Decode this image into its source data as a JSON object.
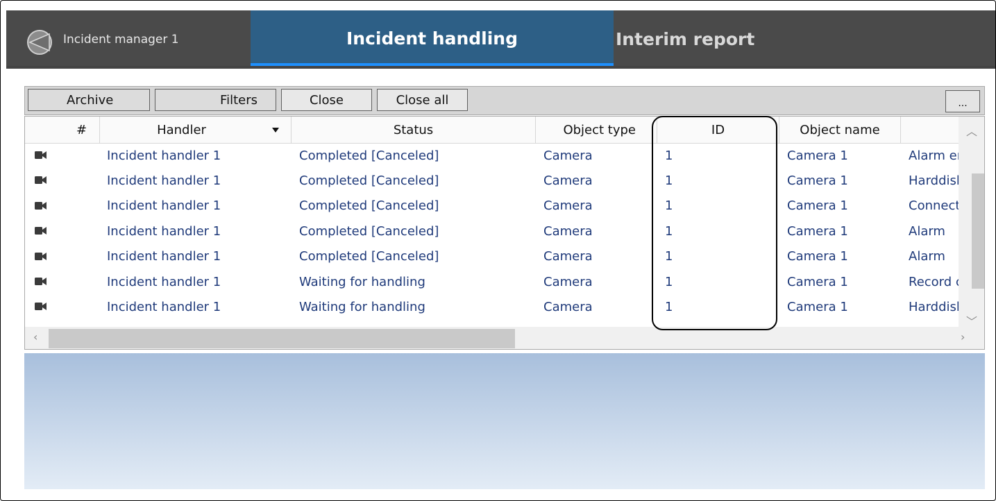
{
  "window": {
    "title": "Incident manager 1",
    "tabs": [
      {
        "label": "Incident handling",
        "active": true
      },
      {
        "label": "Interim report",
        "active": false
      }
    ]
  },
  "toolbar": {
    "archive": "Archive",
    "filters": "Filters",
    "close": "Close",
    "close_all": "Close all",
    "more": "..."
  },
  "table": {
    "columns": [
      "#",
      "Handler",
      "Status",
      "Object type",
      "ID",
      "Object name"
    ],
    "rows": [
      {
        "icon": "camera-icon",
        "handler": "Incident handler 1",
        "status": "Completed [Canceled]",
        "object_type": "Camera",
        "id": "1",
        "object_name": "Camera 1",
        "event": "Alarm er"
      },
      {
        "icon": "camera-icon",
        "handler": "Incident handler 1",
        "status": "Completed [Canceled]",
        "object_type": "Camera",
        "id": "1",
        "object_name": "Camera 1",
        "event": "Harddisk"
      },
      {
        "icon": "camera-icon",
        "handler": "Incident handler 1",
        "status": "Completed [Canceled]",
        "object_type": "Camera",
        "id": "1",
        "object_name": "Camera 1",
        "event": "Connect"
      },
      {
        "icon": "camera-icon",
        "handler": "Incident handler 1",
        "status": "Completed [Canceled]",
        "object_type": "Camera",
        "id": "1",
        "object_name": "Camera 1",
        "event": "Alarm"
      },
      {
        "icon": "camera-icon",
        "handler": "Incident handler 1",
        "status": "Completed [Canceled]",
        "object_type": "Camera",
        "id": "1",
        "object_name": "Camera 1",
        "event": "Alarm"
      },
      {
        "icon": "camera-icon",
        "handler": "Incident handler 1",
        "status": "Waiting for handling",
        "object_type": "Camera",
        "id": "1",
        "object_name": "Camera 1",
        "event": "Record c"
      },
      {
        "icon": "camera-icon",
        "handler": "Incident handler 1",
        "status": "Waiting for handling",
        "object_type": "Camera",
        "id": "1",
        "object_name": "Camera 1",
        "event": "Harddisk"
      }
    ]
  },
  "colors": {
    "header_bar": "#4a4a4a",
    "active_tab": "#2d5f86",
    "tab_underline": "#1e90ff",
    "row_text": "#1f3a7a"
  }
}
